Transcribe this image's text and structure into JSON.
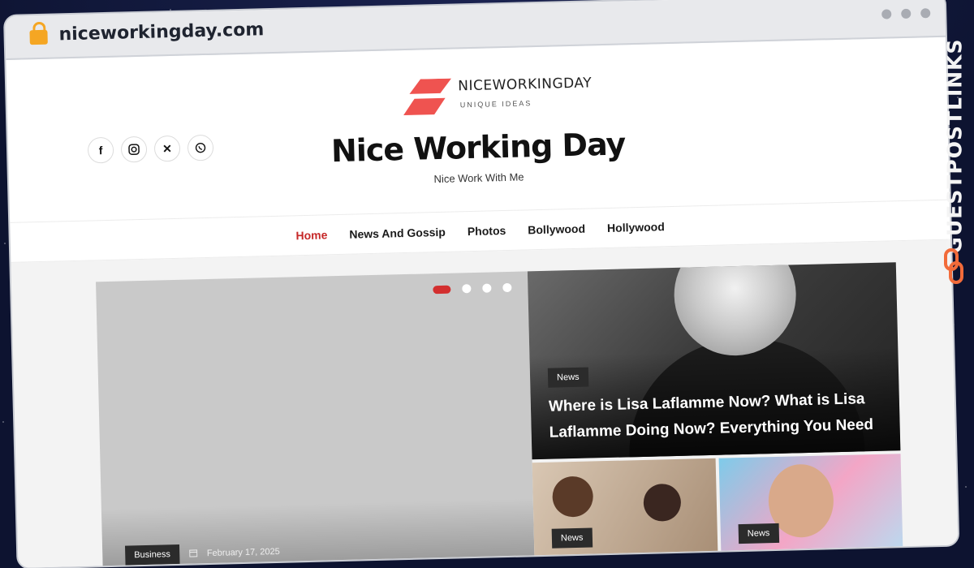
{
  "browser": {
    "url": "niceworkingday.com"
  },
  "site": {
    "brand_name": "NICEWORKINGDAY",
    "brand_tagline": "UNIQUE IDEAS",
    "title": "Nice Working Day",
    "tagline": "Nice Work With Me",
    "accent": "#c62828"
  },
  "social": [
    "facebook-icon",
    "instagram-icon",
    "x-icon",
    "whatsapp-icon"
  ],
  "nav": {
    "items": [
      "Home",
      "News And Gossip",
      "Photos",
      "Bollywood",
      "Hollywood"
    ],
    "active": "Home"
  },
  "slider": {
    "category": "Business",
    "date": "February 17, 2025",
    "pages": 4,
    "current_page": 1
  },
  "featured": {
    "category": "News",
    "title": "Where is Lisa Laflamme Now? What is Lisa Laflamme Doing Now? Everything You Need t…"
  },
  "small_posts": [
    {
      "category": "News"
    },
    {
      "category": "News"
    }
  ],
  "watermark": {
    "text": "GUESTPOSTLINKS"
  }
}
